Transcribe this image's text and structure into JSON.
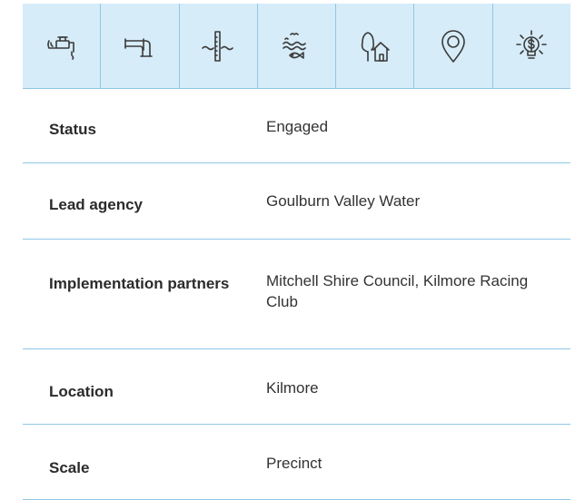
{
  "icons": [
    "water-tap-icon",
    "drain-pipe-icon",
    "water-level-icon",
    "waterway-fish-icon",
    "tree-house-icon",
    "location-pin-icon",
    "lightbulb-dollar-icon"
  ],
  "rows": [
    {
      "label": "Status",
      "value": "Engaged"
    },
    {
      "label": "Lead agency",
      "value": "Goulburn Valley Water"
    },
    {
      "label": "Implementation partners",
      "value": "Mitchell Shire Council, Kilmore Racing Club"
    },
    {
      "label": "Location",
      "value": "Kilmore"
    },
    {
      "label": "Scale",
      "value": "Precinct"
    }
  ],
  "colors": {
    "icon_band": "#d6ecf8",
    "divider": "#8fc7e6",
    "text": "#2b2b2b"
  }
}
